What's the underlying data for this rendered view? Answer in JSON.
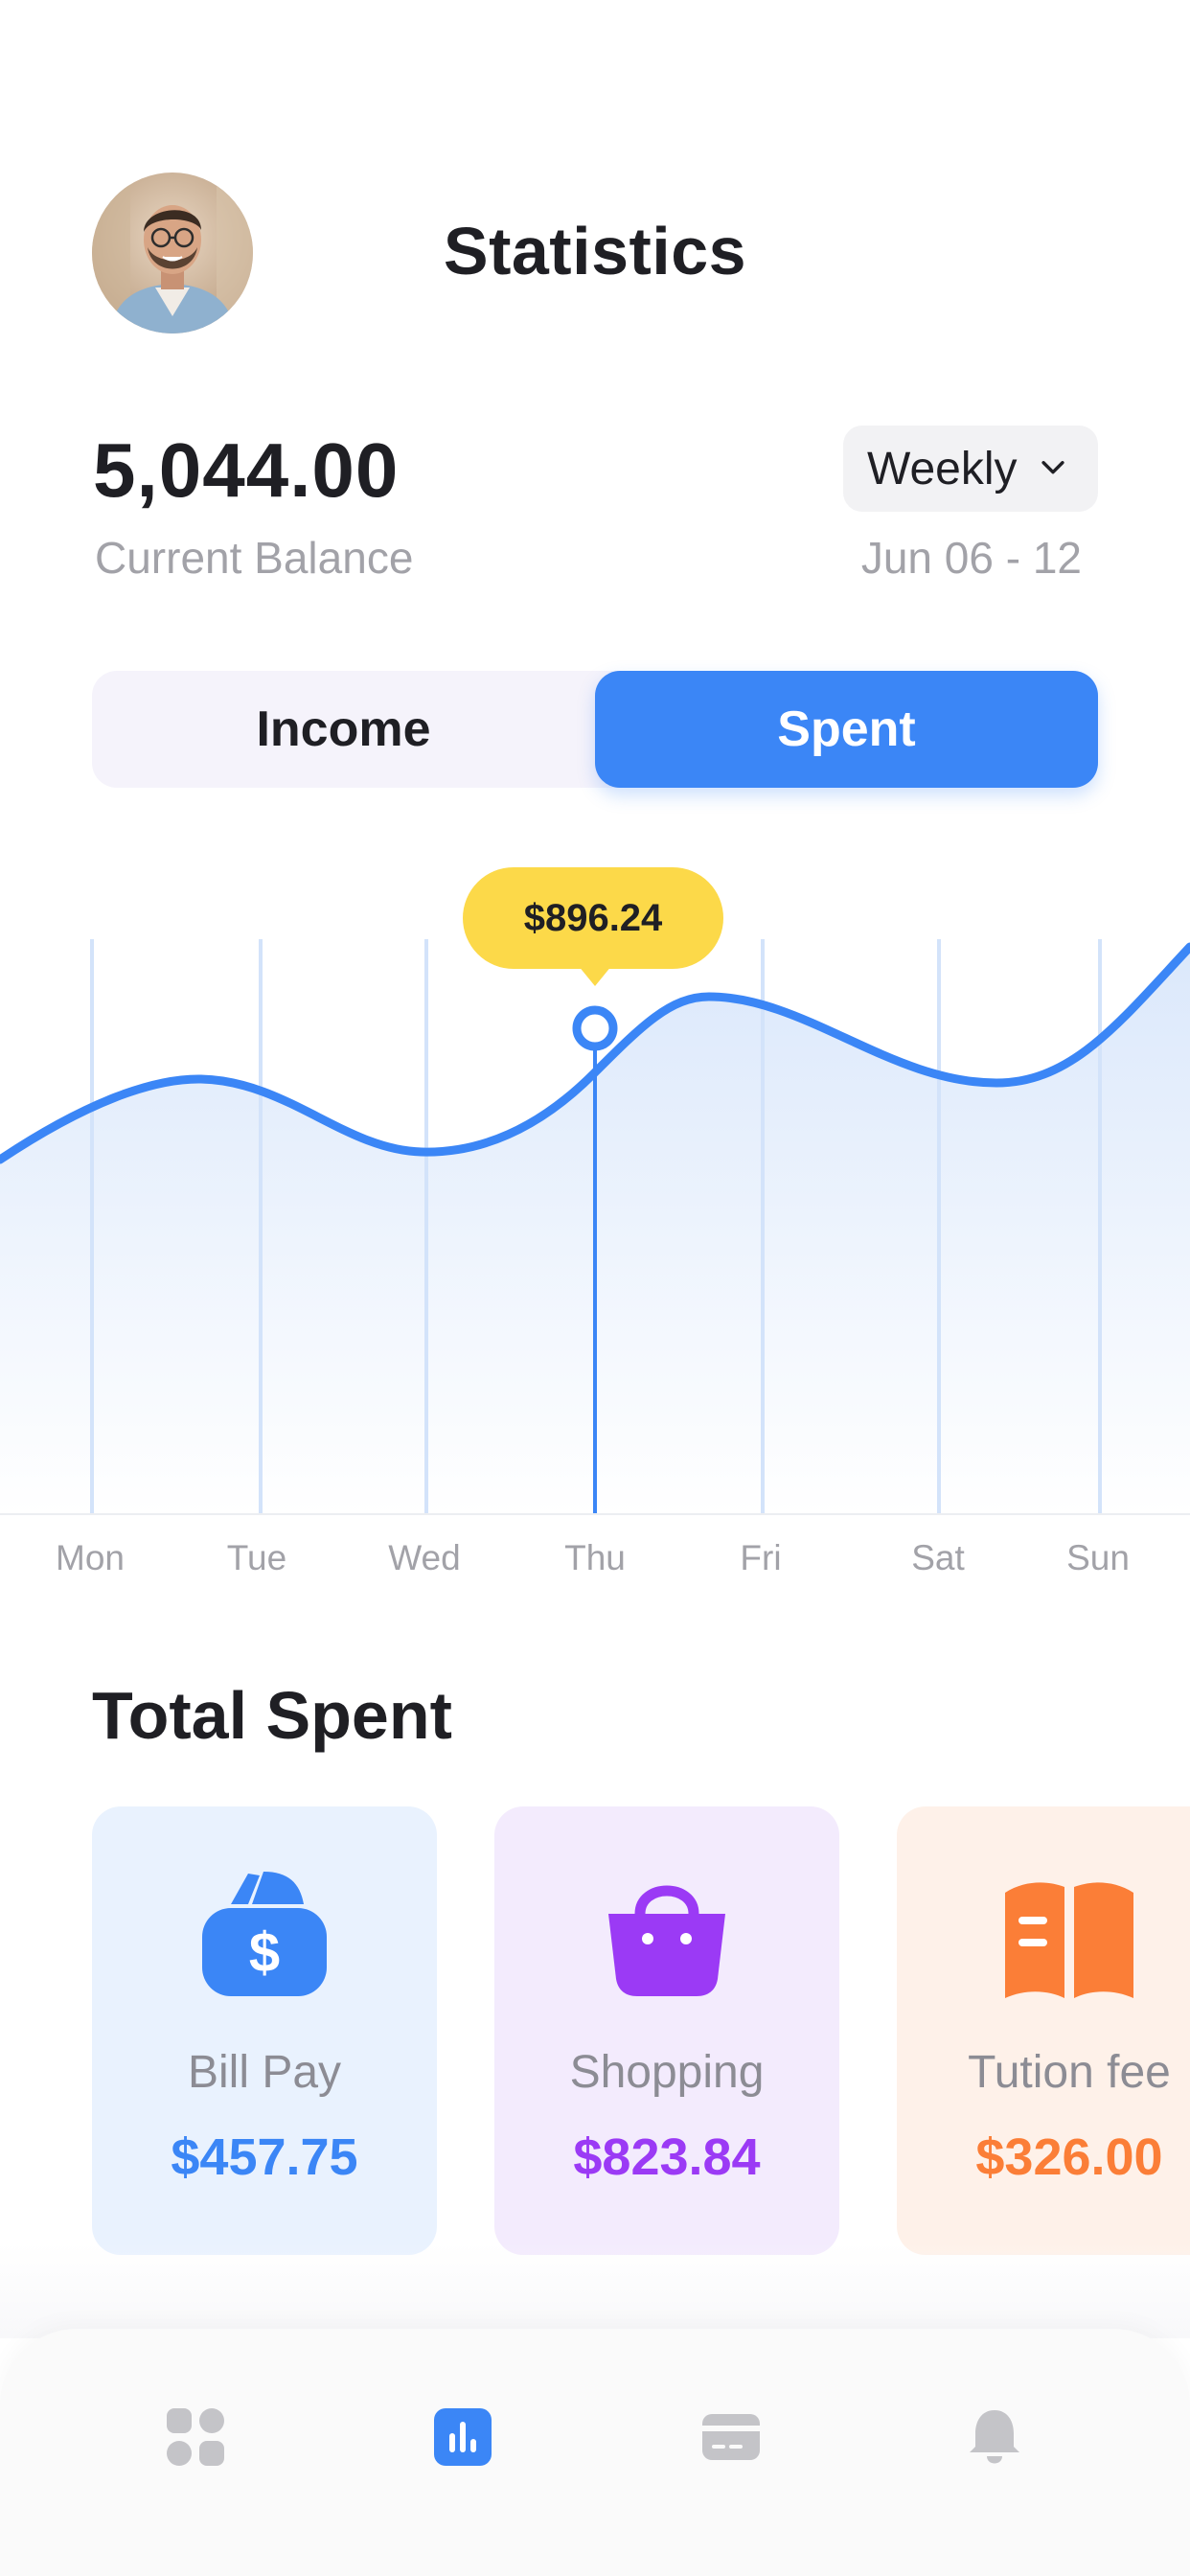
{
  "header": {
    "title": "Statistics"
  },
  "balance": {
    "value": "5,044.00",
    "label": "Current Balance"
  },
  "period": {
    "selected": "Weekly",
    "date_range": "Jun 06 - 12"
  },
  "toggle": {
    "income_label": "Income",
    "spent_label": "Spent",
    "active": "Spent"
  },
  "chart_data": {
    "type": "area",
    "categories": [
      "Mon",
      "Tue",
      "Wed",
      "Thu",
      "Fri",
      "Sat",
      "Sun"
    ],
    "highlight": {
      "category": "Thu",
      "label": "$896.24"
    },
    "colors": {
      "line": "#3b86f6",
      "fill_top": "#dbe8fb",
      "fill_bottom": "#ffffff",
      "tooltip": "#fcd949"
    }
  },
  "total_spent": {
    "title": "Total Spent",
    "cards": [
      {
        "label": "Bill Pay",
        "value": "$457.75",
        "icon": "wallet-dollar-icon",
        "accent": "#3b86f6",
        "background": "#e9f2fe"
      },
      {
        "label": "Shopping",
        "value": "$823.84",
        "icon": "shopping-bag-icon",
        "accent": "#9b3af5",
        "background": "#f3ebfd"
      },
      {
        "label": "Tution fee",
        "value": "$326.00",
        "icon": "book-icon",
        "accent": "#fb7e37",
        "background": "#fef1e9"
      }
    ]
  },
  "tabbar": {
    "items": [
      {
        "icon": "grid-icon",
        "active": false
      },
      {
        "icon": "bar-chart-icon",
        "active": true
      },
      {
        "icon": "credit-card-icon",
        "active": false
      },
      {
        "icon": "bell-icon",
        "active": false
      }
    ]
  }
}
